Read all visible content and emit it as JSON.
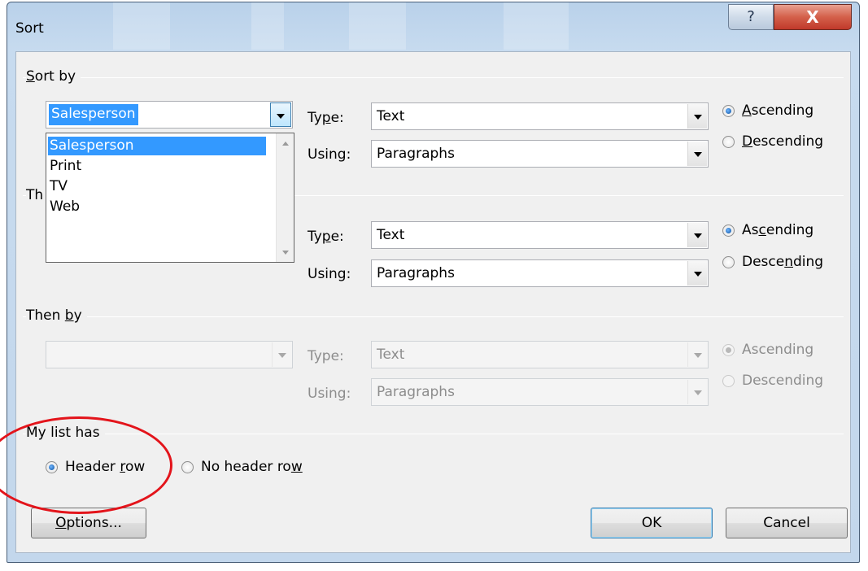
{
  "window": {
    "title": "Sort",
    "help_glyph": "?",
    "close_glyph": "X"
  },
  "sort_by": {
    "group_prefix": "S",
    "group_rest": "ort by",
    "selected": "Salesperson",
    "type_prefix": "Ty",
    "type_u": "p",
    "type_rest": "e:",
    "type_value": "Text",
    "using_label": "Using:",
    "using_value": "Paragraphs",
    "asc_u": "A",
    "asc_rest": "scending",
    "desc_u": "D",
    "desc_rest": "escending",
    "order": "Ascending"
  },
  "dropdown": {
    "items": [
      "Salesperson",
      "Print",
      "TV",
      "Web"
    ],
    "selected_index": 0
  },
  "then_by_1": {
    "group_visible": "Th",
    "type_prefix": "Ty",
    "type_u": "p",
    "type_rest": "e:",
    "type_value": "Text",
    "using_label": "Using:",
    "using_value": "Paragraphs",
    "asc_pre": "As",
    "asc_u": "c",
    "asc_rest": "ending",
    "desc_pre": "Desce",
    "desc_u": "n",
    "desc_rest": "ding",
    "order": "Ascending"
  },
  "then_by_2": {
    "group_pre": "Then ",
    "group_u": "b",
    "group_rest": "y",
    "type_label": "Type:",
    "type_value": "Text",
    "using_label": "Using:",
    "using_value": "Paragraphs",
    "asc_label": "Ascending",
    "desc_label": "Descending",
    "order": "Ascending"
  },
  "list_has": {
    "group_label": "My list has",
    "header_pre": "Header ",
    "header_u": "r",
    "header_rest": "ow",
    "noheader_pre": "No header ro",
    "noheader_u": "w",
    "selected": "Header row"
  },
  "buttons": {
    "options_u": "O",
    "options_rest": "ptions...",
    "ok": "OK",
    "cancel": "Cancel"
  },
  "colors": {
    "annotation": "#e3141b",
    "selection": "#3399ff"
  }
}
